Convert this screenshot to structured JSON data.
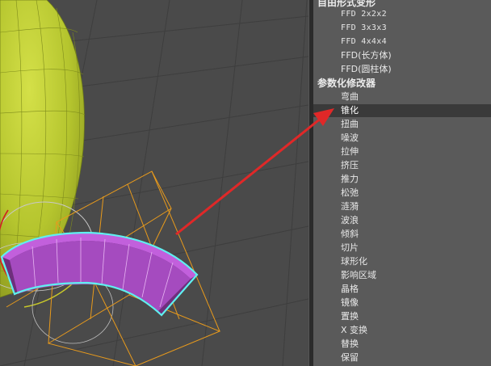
{
  "viewport": {
    "label": "3D viewport"
  },
  "modifier_list": {
    "group_freeform": {
      "label": "自由形式变形"
    },
    "ffd_items": [
      "FFD 2x2x2",
      "FFD 3x3x3",
      "FFD 4x4x4",
      "FFD(长方体)",
      "FFD(圆柱体)"
    ],
    "group_parametric": {
      "label": "参数化修改器"
    },
    "param_items": [
      "弯曲",
      "锥化",
      "扭曲",
      "噪波",
      "拉伸",
      "挤压",
      "推力",
      "松弛",
      "涟漪",
      "波浪",
      "倾斜",
      "切片",
      "球形化",
      "影响区域",
      "晶格",
      "镜像",
      "置换",
      "X 变换",
      "替换",
      "保留"
    ],
    "selected": "锥化"
  },
  "colors": {
    "viewport_bg": "#4a4a4a",
    "panel_bg": "#5a5a5a",
    "selection_bg": "#3a3a3a",
    "sphere": "#b8c830",
    "bent_box": "#b24fc8",
    "gizmo": "#e89a1c",
    "highlight": "#5ff0f0",
    "arrow": "#e02828"
  },
  "icons": [
    "annotation-arrow"
  ]
}
